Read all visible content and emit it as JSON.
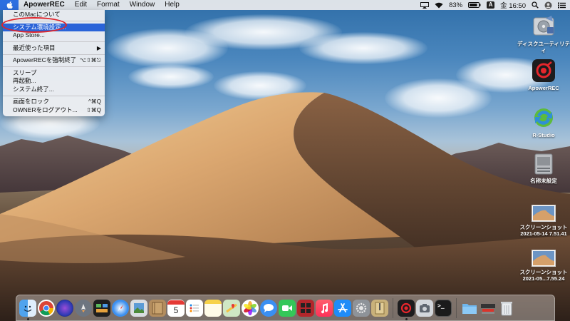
{
  "menubar": {
    "apple_icon": "apple-logo-icon",
    "app_name": "ApowerREC",
    "menus": [
      "Edit",
      "Format",
      "Window",
      "Help"
    ],
    "battery": "83%",
    "input_source": "A",
    "clock": "金 16:50"
  },
  "apple_menu": {
    "items": [
      {
        "label": "このMacについて",
        "shortcut": ""
      },
      {
        "label": "システム環境設定...",
        "shortcut": "",
        "highlighted": true
      },
      {
        "label": "App Store...",
        "shortcut": ""
      },
      {
        "label": "最近使った項目",
        "shortcut": "▶"
      },
      {
        "label": "ApowerRECを強制終了",
        "shortcut": "⌥⇧⌘⎋"
      },
      {
        "label": "スリープ",
        "shortcut": ""
      },
      {
        "label": "再起動...",
        "shortcut": ""
      },
      {
        "label": "システム終了...",
        "shortcut": ""
      },
      {
        "label": "画面をロック",
        "shortcut": "^⌘Q"
      },
      {
        "label": "OWNERをログアウト...",
        "shortcut": "⇧⌘Q"
      }
    ]
  },
  "desktop_icons": [
    {
      "label": "ディスクユーティリテ\nィ",
      "icon": "disk-utility-icon"
    },
    {
      "label": "ApowerREC",
      "icon": "apowerrec-icon"
    },
    {
      "label": "R-Studio",
      "icon": "r-studio-icon"
    },
    {
      "label": "名称未設定",
      "icon": "drive-icon"
    },
    {
      "label": "スクリーンショット\n2021-05-14 7.51.41",
      "icon": "screenshot-thumbnail-icon"
    },
    {
      "label": "スクリーンショット\n2021-05...7.55.24",
      "icon": "screenshot-thumbnail-icon"
    }
  ],
  "dock": {
    "calendar_day": "5",
    "apps": [
      "finder",
      "chrome",
      "siri",
      "launchpad",
      "mission-control",
      "safari",
      "preview",
      "notes-brown",
      "calendar",
      "reminders",
      "notes",
      "maps",
      "photos",
      "messages",
      "facetime",
      "photo-booth",
      "music",
      "app-store",
      "system-preferences",
      "archive",
      "apowerrec",
      "screenshot-util",
      "terminal",
      "folder",
      "downloads-stack",
      "trash"
    ]
  },
  "colors": {
    "menu_highlight": "#2a63d8",
    "annotation": "#e0242a",
    "apowerrec_red": "#e6262c"
  }
}
